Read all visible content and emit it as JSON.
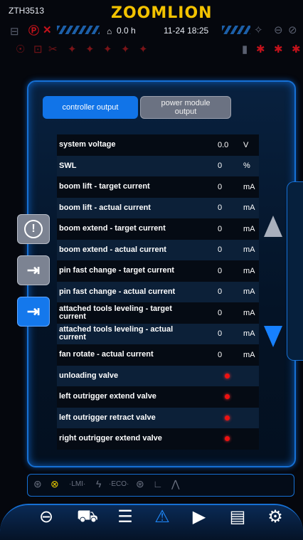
{
  "status": {
    "model": "ZTH3513",
    "brand": "ZOOMLION",
    "hours": "0.0 h",
    "datetime": "11-24 18:25"
  },
  "tabs": {
    "controller_output": "controller output",
    "power_module_output": "power module output"
  },
  "rows": [
    {
      "label": "system voltage",
      "value": "0.0",
      "unit": "V"
    },
    {
      "label": "SWL",
      "value": "0",
      "unit": "%"
    },
    {
      "label": "boom lift - target current",
      "value": "0",
      "unit": "mA"
    },
    {
      "label": "boom lift - actual current",
      "value": "0",
      "unit": "mA"
    },
    {
      "label": "boom extend - target current",
      "value": "0",
      "unit": "mA"
    },
    {
      "label": "boom extend - actual current",
      "value": "0",
      "unit": "mA"
    },
    {
      "label": "pin fast change - target current",
      "value": "0",
      "unit": "mA"
    },
    {
      "label": "pin fast change - actual current",
      "value": "0",
      "unit": "mA"
    },
    {
      "label": "attached tools leveling - target current",
      "value": "0",
      "unit": "mA"
    },
    {
      "label": "attached tools leveling - actual current",
      "value": "0",
      "unit": "mA"
    },
    {
      "label": "fan rotate - actual current",
      "value": "0",
      "unit": "mA"
    }
  ],
  "valves": [
    {
      "label": "unloading valve",
      "state_color": "#e01010"
    },
    {
      "label": "left outrigger extend valve",
      "state_color": "#e01010"
    },
    {
      "label": "left outrigger retract valve",
      "state_color": "#e01010"
    },
    {
      "label": "right outrigger extend valve",
      "state_color": "#e01010"
    }
  ],
  "side_buttons": [
    "info-icon",
    "login-icon",
    "logout-icon"
  ],
  "nav_items": [
    "steering-wheel-icon",
    "telehandler-icon",
    "settings-sliders-icon",
    "warning-icon",
    "play-icon",
    "heater-icon",
    "gear-icon"
  ],
  "colors": {
    "accent": "#1174e8",
    "brand": "#f2c200",
    "alarm": "#c3121b"
  }
}
